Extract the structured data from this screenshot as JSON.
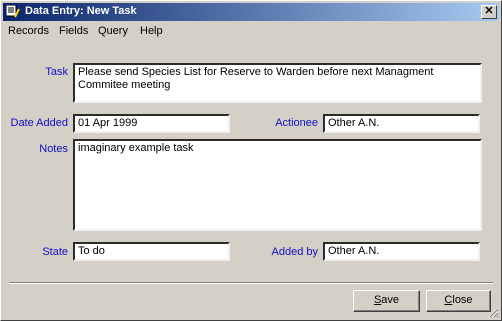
{
  "window": {
    "title": "Data Entry: New Task",
    "close_glyph": "✕"
  },
  "menu": {
    "items": [
      "Records",
      "Fields",
      "Query",
      "Help"
    ]
  },
  "form": {
    "task_label": "Task",
    "task_value": "Please send Species List for Reserve to Warden before next Managment Commitee meeting",
    "date_added_label": "Date Added",
    "date_added_value": "01 Apr 1999",
    "actionee_label": "Actionee",
    "actionee_value": "Other A.N.",
    "notes_label": "Notes",
    "notes_value": "imaginary example task",
    "state_label": "State",
    "state_value": "To do",
    "added_by_label": "Added by",
    "added_by_value": "Other A.N."
  },
  "buttons": {
    "save": {
      "accel": "S",
      "rest": "ave"
    },
    "close": {
      "accel": "C",
      "rest": "lose"
    }
  },
  "colors": {
    "label_blue": "#1010c0",
    "title_start": "#0a246a",
    "title_end": "#a6caf0",
    "face": "#d4d0c8"
  }
}
